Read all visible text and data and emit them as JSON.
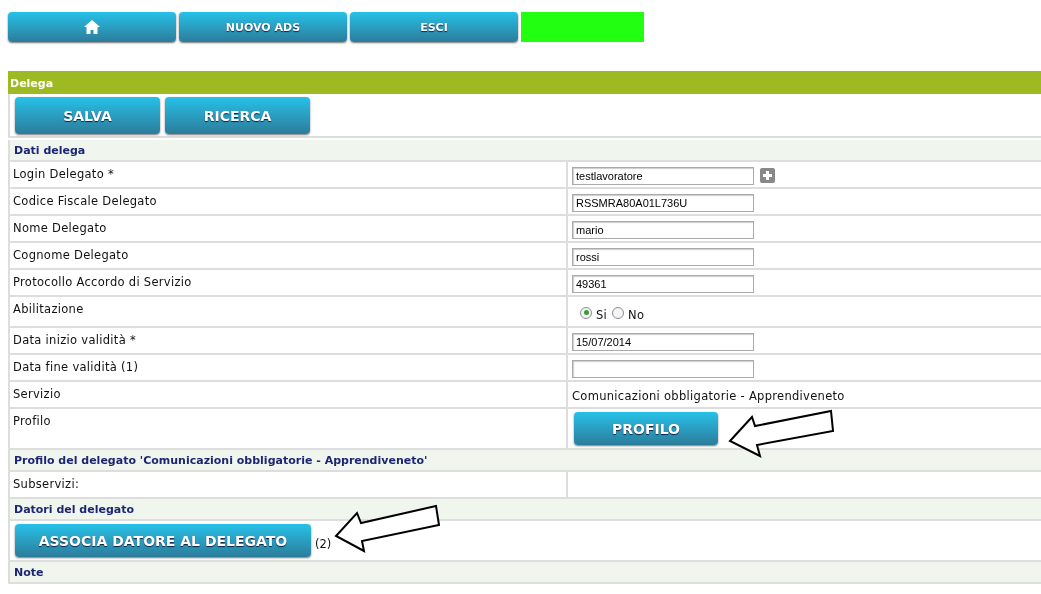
{
  "nav": [
    {
      "kind": "home"
    },
    {
      "kind": "text",
      "label": "NUOVO ADS"
    },
    {
      "kind": "text",
      "label": "ESCI"
    },
    {
      "kind": "indicator",
      "color": "#22ff11"
    }
  ],
  "section": {
    "title": "Delega",
    "actions": [
      "SALVA",
      "RICERCA"
    ]
  },
  "rows": [
    {
      "kind": "header",
      "title": "Dati delega"
    },
    {
      "kind": "field",
      "label": "Login Delegato *",
      "value": "testlavoratore",
      "add_button": true
    },
    {
      "kind": "field",
      "label": "Codice Fiscale Delegato",
      "value": "RSSMRA80A01L736U",
      "add_button": false
    },
    {
      "kind": "field",
      "label": "Nome Delegato",
      "value": "mario",
      "add_button": false
    },
    {
      "kind": "field",
      "label": "Cognome Delegato",
      "value": "rossi",
      "add_button": false
    },
    {
      "kind": "field",
      "label": "Protocollo Accordo di Servizio",
      "value": "49361",
      "add_button": false
    },
    {
      "kind": "radio",
      "label": "Abilitazione",
      "options": [
        {
          "label": "Si",
          "selected": true
        },
        {
          "label": "No",
          "selected": false
        }
      ]
    },
    {
      "kind": "field",
      "label": "Data inizio validità *",
      "value": "15/07/2014",
      "add_button": false
    },
    {
      "kind": "field",
      "label": "Data fine validità (1)",
      "add_button": false
    },
    {
      "kind": "text",
      "label": "Servizio",
      "value": "Comunicazioni obbligatorie - Apprendiveneto"
    },
    {
      "kind": "button",
      "label": "Profilo",
      "button": "PROFILO"
    },
    {
      "kind": "header",
      "title": "Profilo del delegato 'Comunicazioni obbligatorie - Apprendiveneto'"
    },
    {
      "kind": "text",
      "label": "Subservizi:"
    },
    {
      "kind": "header",
      "title": "Datori del delegato"
    },
    {
      "kind": "action",
      "button": "ASSOCIA DATORE AL DELEGATO",
      "note": "(2)"
    },
    {
      "kind": "header",
      "title": "Note"
    }
  ]
}
